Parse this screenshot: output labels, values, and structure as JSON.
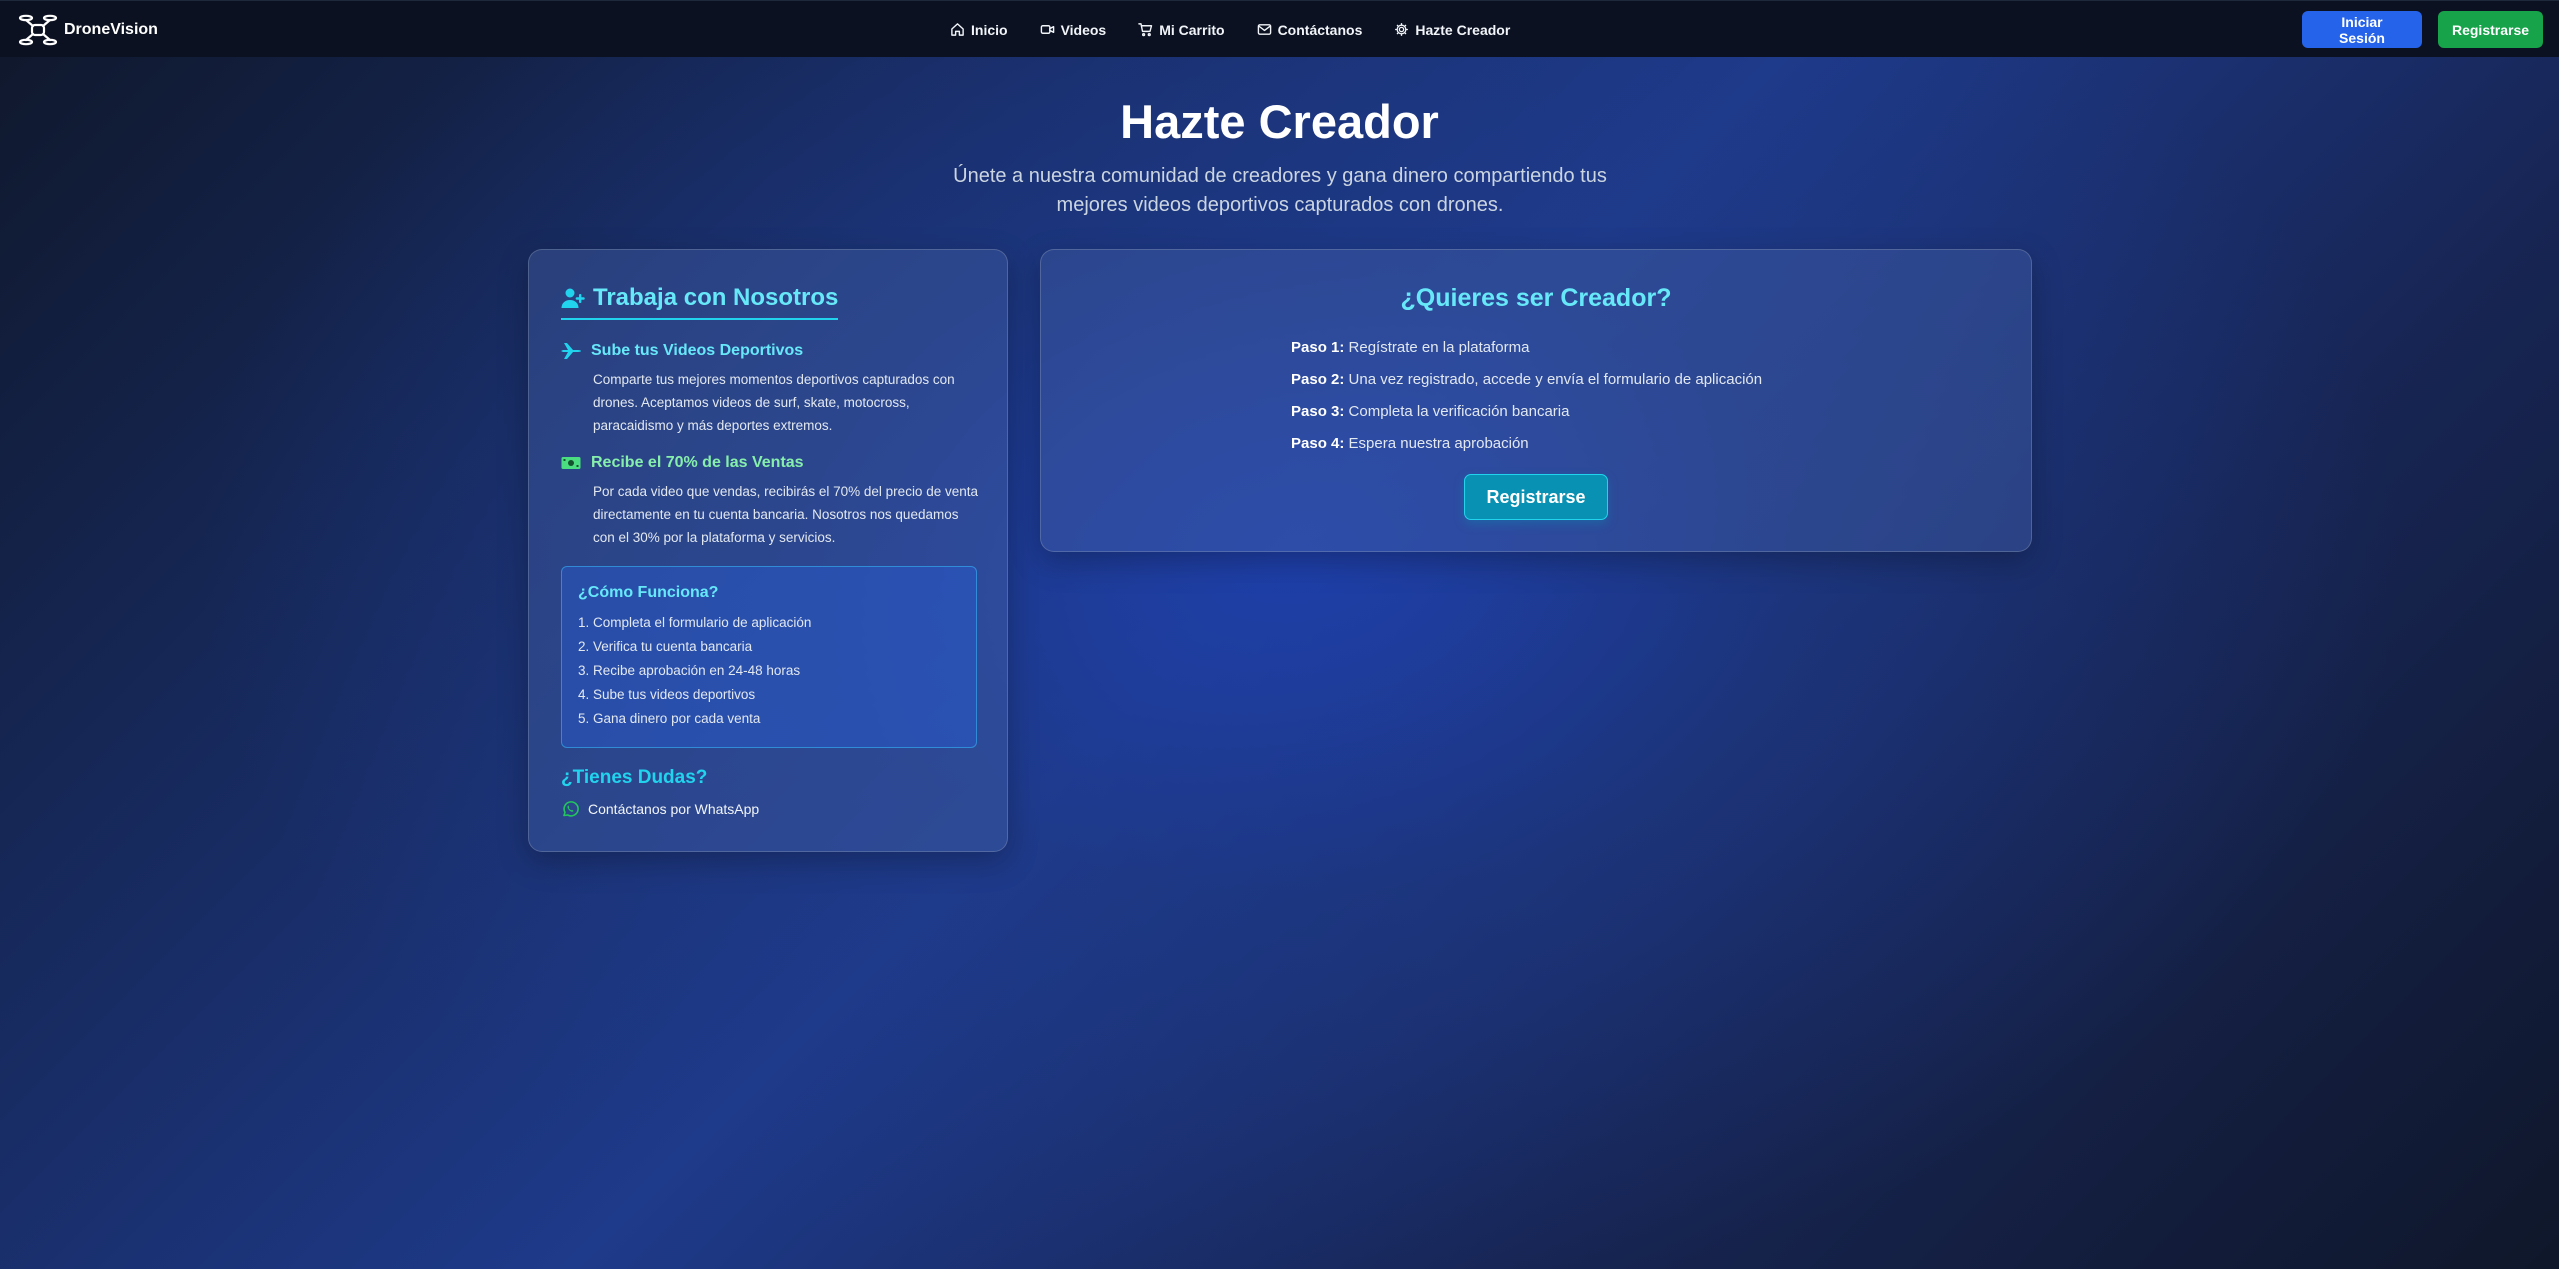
{
  "brand": {
    "name": "DroneVision",
    "logo_icon": "drone-icon"
  },
  "nav": {
    "items": [
      {
        "label": "Inicio",
        "icon": "home-icon"
      },
      {
        "label": "Videos",
        "icon": "video-camera-icon"
      },
      {
        "label": "Mi Carrito",
        "icon": "cart-icon"
      },
      {
        "label": "Contáctanos",
        "icon": "mail-icon"
      },
      {
        "label": "Hazte Creador",
        "icon": "gear-icon"
      }
    ],
    "login_label": "Iniciar Sesión",
    "register_label": "Registrarse"
  },
  "hero": {
    "title": "Hazte Creador",
    "subtitle": "Únete a nuestra comunidad de creadores y gana dinero compartiendo tus mejores videos deportivos capturados con drones."
  },
  "work_card": {
    "title": "Trabaja con Nosotros",
    "features": [
      {
        "title": "Sube tus Videos Deportivos",
        "text": "Comparte tus mejores momentos deportivos capturados con drones. Aceptamos videos de surf, skate, motocross, paracaidismo y más deportes extremos."
      },
      {
        "title": "Recibe el 70% de las Ventas",
        "text": "Por cada video que vendas, recibirás el 70% del precio de venta directamente en tu cuenta bancaria. Nosotros nos quedamos con el 30% por la plataforma y servicios."
      }
    ],
    "how_it_works": {
      "title": "¿Cómo Funciona?",
      "items": [
        "1. Completa el formulario de aplicación",
        "2. Verifica tu cuenta bancaria",
        "3. Recibe aprobación en 24-48 horas",
        "4. Sube tus videos deportivos",
        "5. Gana dinero por cada venta"
      ]
    },
    "doubts": {
      "title": "¿Tienes Dudas?",
      "whatsapp_label": "Contáctanos por WhatsApp"
    }
  },
  "creator_card": {
    "title": "¿Quieres ser Creador?",
    "steps": [
      {
        "label": "Paso 1:",
        "text": " Regístrate en la plataforma"
      },
      {
        "label": "Paso 2:",
        "text": " Una vez registrado, accede y envía el formulario de aplicación"
      },
      {
        "label": "Paso 3:",
        "text": " Completa la verificación bancaria"
      },
      {
        "label": "Paso 4:",
        "text": " Espera nuestra aprobación"
      }
    ],
    "button_label": "Registrarse"
  },
  "colors": {
    "accent_cyan": "#67e8f9",
    "accent_green": "#86efac",
    "login_blue": "#2563eb",
    "register_green": "#16a34a",
    "cta_teal": "#0891b2"
  }
}
